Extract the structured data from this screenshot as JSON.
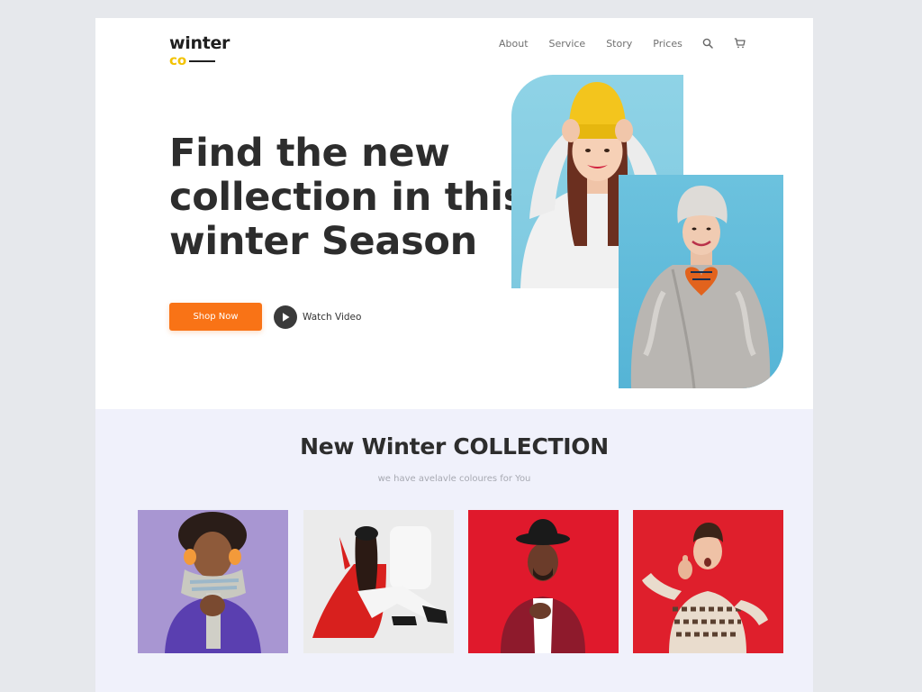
{
  "brand": {
    "name_top": "winter",
    "name_bottom": "co"
  },
  "nav": {
    "links": [
      "About",
      "Service",
      "Story",
      "Prices"
    ],
    "icons": [
      "search-icon",
      "cart-icon"
    ]
  },
  "hero": {
    "title_lines": [
      "Find the new",
      "collection in this",
      "winter Season"
    ],
    "shop_button": "Shop Now",
    "watch_label": "Watch Video"
  },
  "collection": {
    "title": "New Winter COLLECTION",
    "subtitle": "we have avelavle coloures for You",
    "cards": [
      "purple-scarf-model",
      "red-coat-model",
      "burgundy-blazer-model",
      "sweater-thumbs-up-model"
    ]
  },
  "colors": {
    "accent": "#f97316",
    "logo_yellow": "#f2c200",
    "section_bg": "#f0f1fb",
    "text_dark": "#2d2d2d"
  }
}
